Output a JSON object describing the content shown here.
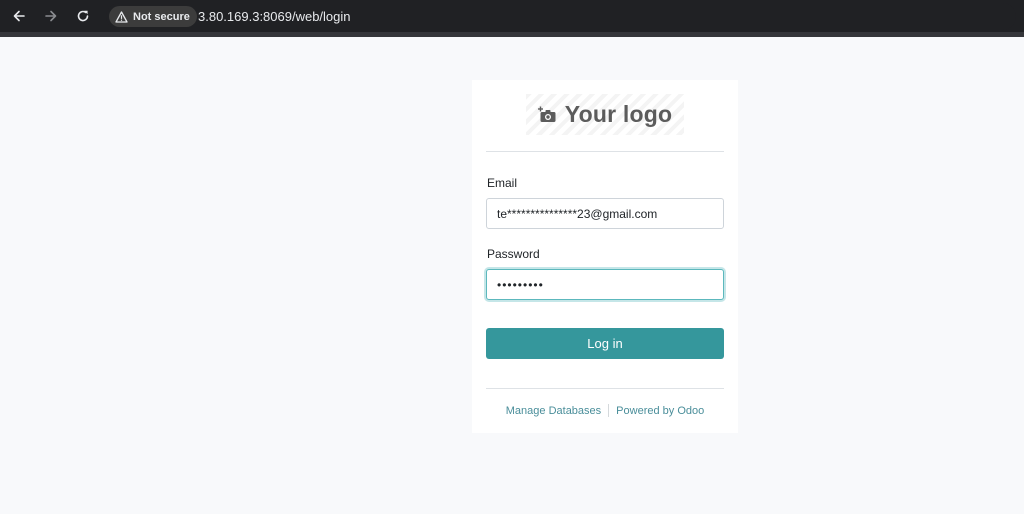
{
  "browser": {
    "security_label": "Not secure",
    "url": "3.80.169.3:8069/web/login",
    "icons": {
      "back": "arrow-left-icon",
      "forward": "arrow-right-icon",
      "reload": "reload-icon",
      "security": "warning-triangle-icon"
    }
  },
  "login": {
    "logo_text": "Your logo",
    "logo_icon": "camera-plus-icon",
    "email_label": "Email",
    "email_value": "te***************23@gmail.com",
    "password_label": "Password",
    "password_value": "•••••••••",
    "submit_label": "Log in",
    "links": {
      "manage_databases": "Manage Databases",
      "powered_by": "Powered by Odoo"
    }
  },
  "colors": {
    "primary_button": "#35979c",
    "link": "#4a8e9a",
    "focus_border": "#5cb8bd",
    "page_background": "#f8f9fb"
  }
}
